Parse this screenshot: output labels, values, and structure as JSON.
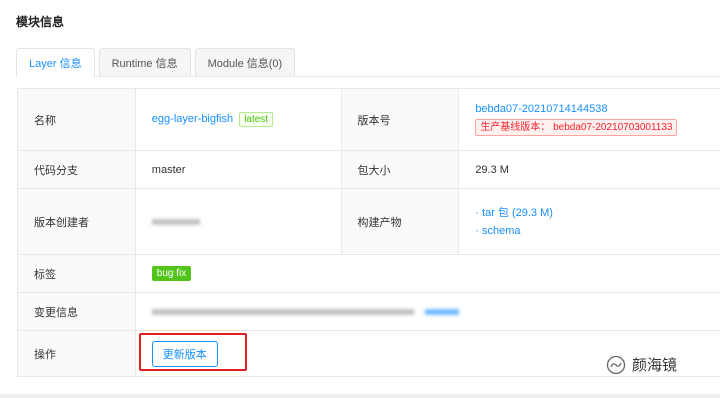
{
  "section": {
    "title": "模块信息"
  },
  "tabs": [
    {
      "label": "Layer 信息",
      "active": true
    },
    {
      "label": "Runtime 信息",
      "active": false
    },
    {
      "label": "Module 信息(0)",
      "active": false
    }
  ],
  "info": {
    "name_label": "名称",
    "name_value": "egg-layer-bigfish",
    "name_tag": "latest",
    "version_label": "版本号",
    "version_value": "bebda07-20210714144538",
    "baseline_tag": "生产基线版本： bebda07-20210703001133",
    "branch_label": "代码分支",
    "branch_value": "master",
    "size_label": "包大小",
    "size_value": "29.3 M",
    "creator_label": "版本创建者",
    "artifacts_label": "构建产物",
    "artifacts": [
      "· tar 包 (29.3 M)",
      "· schema"
    ],
    "tags_label": "标签",
    "tag_value": "bug fix",
    "change_label": "变更信息",
    "action_label": "操作",
    "action_button": "更新版本"
  },
  "watermark": {
    "text": "颜海镜"
  },
  "colors": {
    "accent": "#1890ff",
    "danger": "#f5222d",
    "success": "#52c41a",
    "highlight": "#e02020"
  }
}
